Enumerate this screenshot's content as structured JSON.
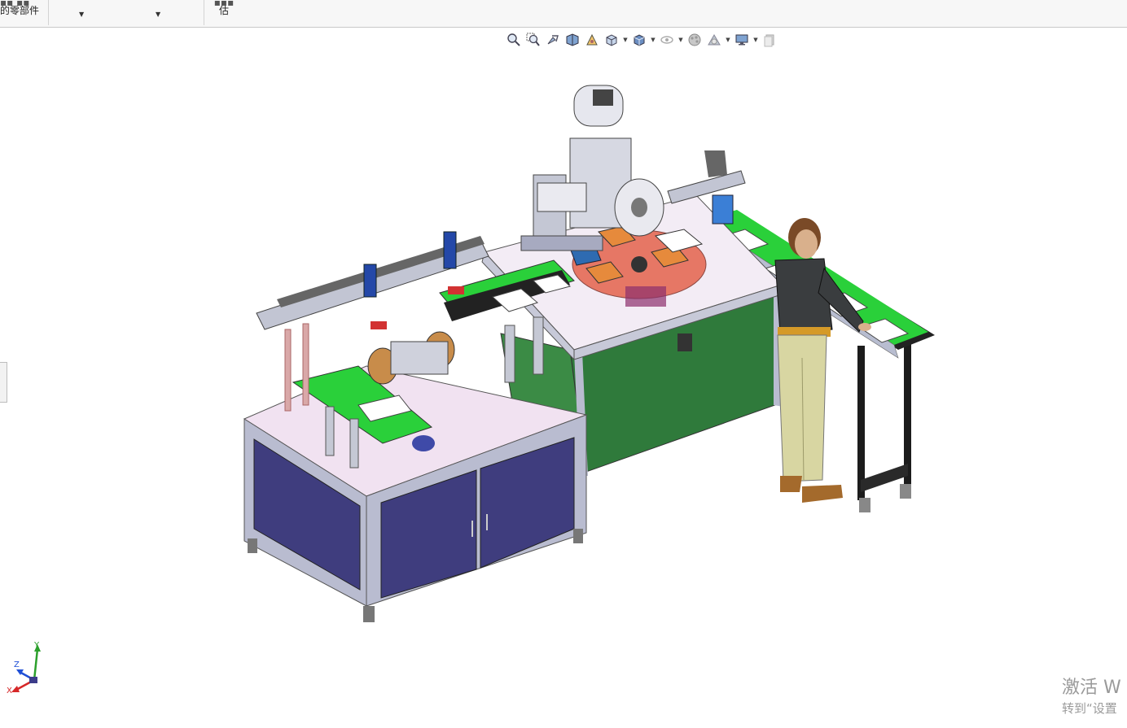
{
  "ribbon": {
    "parts_label_line1": "的零部件",
    "eval_label_line1": "估"
  },
  "view_toolbar": {
    "icons": [
      "zoom-to-fit-icon",
      "zoom-area-icon",
      "previous-view-icon",
      "section-view-icon",
      "dynamic-annotation-icon",
      "view-orientation-icon",
      "display-style-icon",
      "hide-show-items-icon",
      "edit-appearance-icon",
      "apply-scene-icon",
      "view-settings-icon",
      "display-pane-icon"
    ]
  },
  "watermark": {
    "title": "激活 W",
    "subtitle": "转到“设置"
  },
  "triad": {
    "x_label": "X",
    "y_label": "Y",
    "z_label": "Z"
  },
  "colors": {
    "cabinet_door": "#3f3d7e",
    "frame": "#b9bcd0",
    "table_top": "#f1e2f1",
    "conveyor_belt": "#2fd12f",
    "enclosure": "#2f7a3b",
    "turntable": "#e0604a",
    "fixture": "#e68a3c",
    "operator_jacket": "#3a3d3f",
    "operator_pants": "#d8d6a2"
  }
}
